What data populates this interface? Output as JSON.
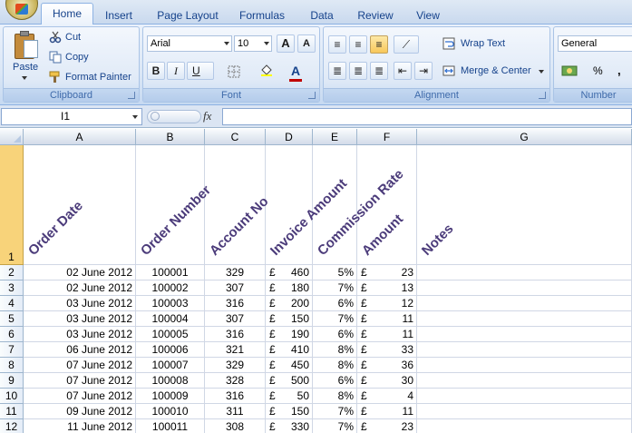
{
  "ribbon": {
    "tabs": [
      "Home",
      "Insert",
      "Page Layout",
      "Formulas",
      "Data",
      "Review",
      "View"
    ],
    "active_tab": "Home",
    "clipboard": {
      "paste": "Paste",
      "cut": "Cut",
      "copy": "Copy",
      "format_painter": "Format Painter",
      "label": "Clipboard"
    },
    "font": {
      "family": "Arial",
      "size": "10",
      "bold": "B",
      "italic": "I",
      "underline": "U",
      "grow": "A",
      "shrink": "A",
      "font_color": "A",
      "label": "Font"
    },
    "alignment": {
      "wrap_text": "Wrap Text",
      "merge_center": "Merge & Center",
      "label": "Alignment"
    },
    "number": {
      "format": "General",
      "percent": "%",
      "comma": ",",
      "label": "Number"
    }
  },
  "formula_bar": {
    "name_box": "I1",
    "fx": "fx",
    "formula": ""
  },
  "columns": [
    "A",
    "B",
    "C",
    "D",
    "E",
    "F",
    "G"
  ],
  "headers": [
    "Order Date",
    "Order Number",
    "Account No",
    "Invoice Amount",
    "Commission Rate",
    "Amount",
    "Notes"
  ],
  "rows": [
    {
      "n": "2",
      "date": "02 June 2012",
      "order": "100001",
      "account": "329",
      "cur1": "£",
      "invoice": "460",
      "rate": "5%",
      "cur2": "£",
      "amount": "23"
    },
    {
      "n": "3",
      "date": "02 June 2012",
      "order": "100002",
      "account": "307",
      "cur1": "£",
      "invoice": "180",
      "rate": "7%",
      "cur2": "£",
      "amount": "13"
    },
    {
      "n": "4",
      "date": "03 June 2012",
      "order": "100003",
      "account": "316",
      "cur1": "£",
      "invoice": "200",
      "rate": "6%",
      "cur2": "£",
      "amount": "12"
    },
    {
      "n": "5",
      "date": "03 June 2012",
      "order": "100004",
      "account": "307",
      "cur1": "£",
      "invoice": "150",
      "rate": "7%",
      "cur2": "£",
      "amount": "11"
    },
    {
      "n": "6",
      "date": "03 June 2012",
      "order": "100005",
      "account": "316",
      "cur1": "£",
      "invoice": "190",
      "rate": "6%",
      "cur2": "£",
      "amount": "11"
    },
    {
      "n": "7",
      "date": "06 June 2012",
      "order": "100006",
      "account": "321",
      "cur1": "£",
      "invoice": "410",
      "rate": "8%",
      "cur2": "£",
      "amount": "33"
    },
    {
      "n": "8",
      "date": "07 June 2012",
      "order": "100007",
      "account": "329",
      "cur1": "£",
      "invoice": "450",
      "rate": "8%",
      "cur2": "£",
      "amount": "36"
    },
    {
      "n": "9",
      "date": "07 June 2012",
      "order": "100008",
      "account": "328",
      "cur1": "£",
      "invoice": "500",
      "rate": "6%",
      "cur2": "£",
      "amount": "30"
    },
    {
      "n": "10",
      "date": "07 June 2012",
      "order": "100009",
      "account": "316",
      "cur1": "£",
      "invoice": "50",
      "rate": "8%",
      "cur2": "£",
      "amount": "4"
    },
    {
      "n": "11",
      "date": "09 June 2012",
      "order": "100010",
      "account": "311",
      "cur1": "£",
      "invoice": "150",
      "rate": "7%",
      "cur2": "£",
      "amount": "11"
    },
    {
      "n": "12",
      "date": "11 June 2012",
      "order": "100011",
      "account": "308",
      "cur1": "£",
      "invoice": "330",
      "rate": "7%",
      "cur2": "£",
      "amount": "23"
    }
  ],
  "header_row_number": "1"
}
